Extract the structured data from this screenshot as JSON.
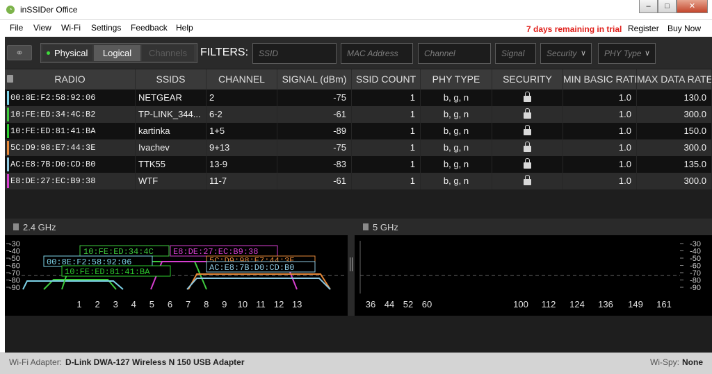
{
  "window": {
    "title": "inSSIDer Office",
    "minimize": "–",
    "maximize": "□",
    "close": "✕",
    "icon": "wifi-app-icon"
  },
  "menu": {
    "items": [
      "File",
      "View",
      "Wi-Fi",
      "Settings",
      "Feedback",
      "Help"
    ],
    "trial": "7 days remaining in trial",
    "register": "Register",
    "buy": "Buy Now"
  },
  "filters": {
    "link_icon": "link-icon",
    "physical": "Physical",
    "logical": "Logical",
    "channels": "Channels",
    "label": "FILTERS:",
    "ssid_placeholder": "SSID",
    "mac_placeholder": "MAC Address",
    "channel_placeholder": "Channel",
    "signal_placeholder": "Signal",
    "security_label": "Security",
    "phy_label": "PHY Type"
  },
  "table": {
    "headers": [
      "RADIO",
      "SSIDS",
      "CHANNEL",
      "SIGNAL (dBm)",
      "SSID COUNT",
      "PHY TYPE",
      "SECURITY",
      "MIN BASIC RATE",
      "MAX DATA RATE"
    ],
    "rows": [
      {
        "radio": "00:8E:F2:58:92:06",
        "ssid": "NETGEAR",
        "channel": "2",
        "signal": "-75",
        "count": "1",
        "phy": "b, g, n",
        "min": "1.0",
        "max": "130.0",
        "color": "#7dd3e8",
        "linked": false
      },
      {
        "radio": "10:FE:ED:34:4C:B2",
        "ssid": "TP-LINK_344...",
        "channel": "6-2",
        "signal": "-61",
        "count": "1",
        "phy": "b, g, n",
        "min": "1.0",
        "max": "300.0",
        "color": "#3ecb3e",
        "linked": false
      },
      {
        "radio": "10:FE:ED:81:41:BA",
        "ssid": "kartinka",
        "channel": "1+5",
        "signal": "-89",
        "count": "1",
        "phy": "b, g, n",
        "min": "1.0",
        "max": "150.0",
        "color": "#2ecc2e",
        "linked": false
      },
      {
        "radio": "5C:D9:98:E7:44:3E",
        "ssid": "Ivachev",
        "channel": "9+13",
        "signal": "-75",
        "count": "1",
        "phy": "b, g, n",
        "min": "1.0",
        "max": "300.0",
        "color": "#e88a3a",
        "linked": false
      },
      {
        "radio": "AC:E8:7B:D0:CD:B0",
        "ssid": "TTK55",
        "channel": "13-9",
        "signal": "-83",
        "count": "1",
        "phy": "b, g, n",
        "min": "1.0",
        "max": "135.0",
        "color": "#8ec8e0",
        "linked": false
      },
      {
        "radio": "E8:DE:27:EC:B9:38",
        "ssid": "WTF",
        "channel": "11-7",
        "signal": "-61",
        "count": "1",
        "phy": "b, g, n",
        "min": "1.0",
        "max": "300.0",
        "color": "#d63fd0",
        "linked": true
      }
    ]
  },
  "graphs": {
    "band24": {
      "title": "2.4 GHz",
      "y_ticks": [
        "-30",
        "-40",
        "-50",
        "-60",
        "-70",
        "-80",
        "-90"
      ],
      "x_ticks": [
        "1",
        "2",
        "3",
        "4",
        "5",
        "6",
        "7",
        "8",
        "9",
        "10",
        "11",
        "12",
        "13"
      ]
    },
    "band5": {
      "title": "5 GHz",
      "y_ticks": [
        "-30",
        "-40",
        "-50",
        "-60",
        "-70",
        "-80",
        "-90"
      ],
      "x_ticks": [
        "36",
        "44",
        "52",
        "60",
        "100",
        "112",
        "124",
        "136",
        "149",
        "161"
      ]
    },
    "labels": [
      {
        "text": "10:FE:ED:34:4C",
        "color": "#3ecb3e"
      },
      {
        "text": "E8:DE:27:EC:B9:38",
        "color": "#d63fd0"
      },
      {
        "text": "00:8E:F2:58:92:06",
        "color": "#7dd3e8"
      },
      {
        "text": "5C:D9:98:E7:44:3E",
        "color": "#e88a3a"
      },
      {
        "text": "AC:E8:7B:D0:CD:B0",
        "color": "#8ec8e0"
      },
      {
        "text": "10:FE:ED:81:41:BA",
        "color": "#2ecc2e"
      }
    ]
  },
  "status": {
    "adapter_label": "Wi-Fi Adapter:",
    "adapter_value": "D-Link DWA-127 Wireless N 150 USB Adapter",
    "spy_label": "Wi-Spy:",
    "spy_value": "None"
  }
}
